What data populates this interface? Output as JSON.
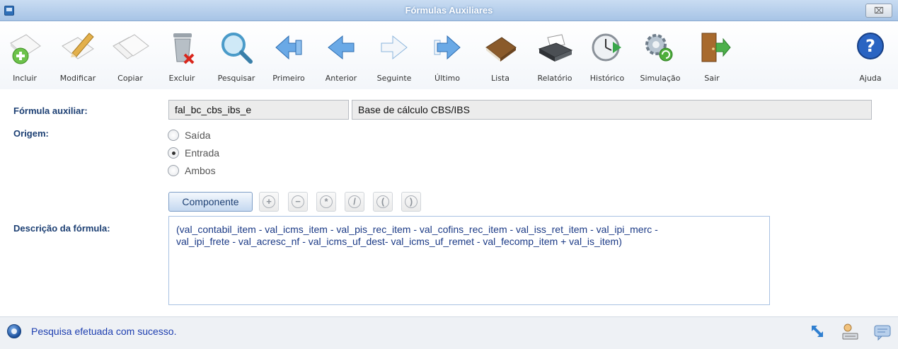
{
  "window": {
    "title": "Fórmulas Auxiliares",
    "close_label": "⌧"
  },
  "toolbar": {
    "incluir": "Incluir",
    "modificar": "Modificar",
    "copiar": "Copiar",
    "excluir": "Excluir",
    "pesquisar": "Pesquisar",
    "primeiro": "Primeiro",
    "anterior": "Anterior",
    "seguinte": "Seguinte",
    "ultimo": "Último",
    "lista": "Lista",
    "relatorio": "Relatório",
    "historico": "Histórico",
    "simulacao": "Simulação",
    "sair": "Sair",
    "ajuda": "Ajuda"
  },
  "form": {
    "formula_label": "Fórmula auxiliar:",
    "formula_code": "fal_bc_cbs_ibs_e",
    "formula_name": "Base de cálculo CBS/IBS",
    "origem_label": "Origem:",
    "origem_options": [
      "Saída",
      "Entrada",
      "Ambos"
    ],
    "origem_selected": "Entrada",
    "componente_label": "Componente",
    "operators": [
      "+",
      "−",
      "*",
      "/",
      "(",
      ")"
    ],
    "descricao_label": "Descrição da fórmula:",
    "descricao_line1": "(val_contabil_item - val_icms_item - val_pis_rec_item - val_cofins_rec_item - val_iss_ret_item - val_ipi_merc -",
    "descricao_line2": "val_ipi_frete - val_acresc_nf - val_icms_uf_dest- val_icms_uf_remet - val_fecomp_item + val_is_item)"
  },
  "status": {
    "message": "Pesquisa efetuada com sucesso."
  },
  "colors": {
    "accent": "#1c3f73",
    "status_text": "#1e3fb0",
    "titlebar": "#a7c4e6"
  }
}
